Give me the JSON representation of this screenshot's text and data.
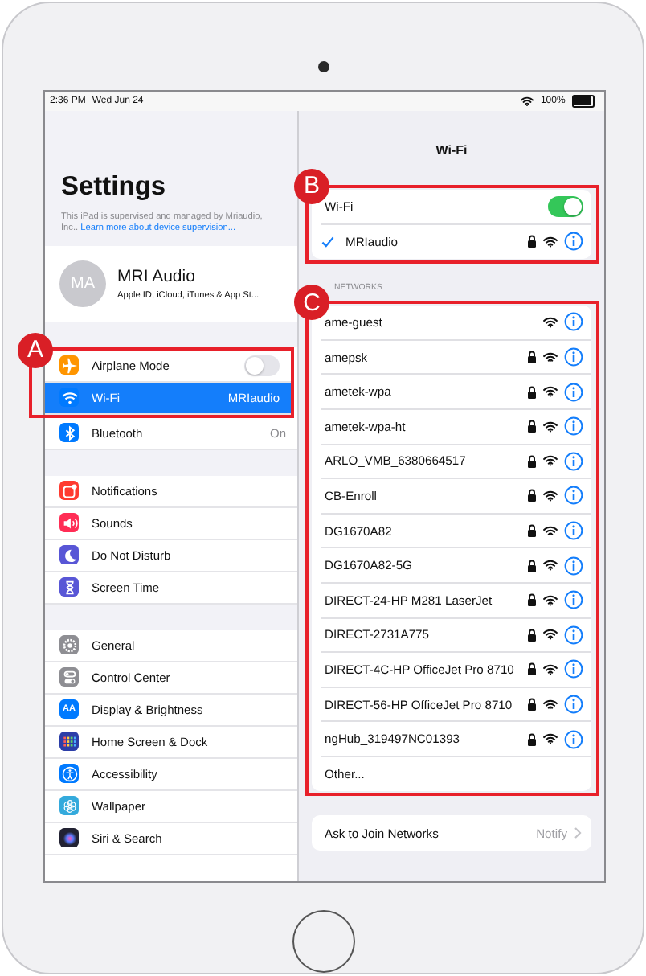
{
  "status_bar": {
    "time": "2:36 PM",
    "date": "Wed Jun 24",
    "battery": "100%"
  },
  "sidebar": {
    "title": "Settings",
    "notice": "This iPad is supervised and managed by Mriaudio, Inc.. ",
    "notice_link": "Learn more about device supervision...",
    "profile": {
      "initials": "MA",
      "name": "MRI Audio",
      "subtitle": "Apple ID, iCloud, iTunes & App St..."
    },
    "sections": [
      {
        "callout": "A",
        "items": [
          {
            "label": "Airplane Mode",
            "color": "#ff9500",
            "kind": "toggle",
            "on": false,
            "selected": false
          },
          {
            "label": "Wi-Fi",
            "color": "#007aff",
            "kind": "link",
            "value": "MRIaudio",
            "selected": true
          }
        ]
      },
      {
        "joined": true,
        "items": [
          {
            "label": "Bluetooth",
            "color": "#007aff",
            "kind": "link",
            "value": "On",
            "selected": false
          }
        ]
      },
      {
        "items": [
          {
            "label": "Notifications",
            "color": "#ff3b30",
            "kind": "link",
            "selected": false
          },
          {
            "label": "Sounds",
            "color": "#ff2d55",
            "kind": "link",
            "selected": false
          },
          {
            "label": "Do Not Disturb",
            "color": "#5856d6",
            "kind": "link",
            "selected": false
          },
          {
            "label": "Screen Time",
            "color": "#5856d6",
            "kind": "link",
            "selected": false
          }
        ]
      },
      {
        "items": [
          {
            "label": "General",
            "color": "#8e8e93",
            "kind": "link",
            "selected": false
          },
          {
            "label": "Control Center",
            "color": "#8e8e93",
            "kind": "link",
            "selected": false
          },
          {
            "label": "Display & Brightness",
            "glyph": "AA",
            "color": "#007aff",
            "kind": "link",
            "selected": false
          },
          {
            "label": "Home Screen & Dock",
            "color": "#2c3ea8",
            "kind": "link",
            "selected": false
          },
          {
            "label": "Accessibility",
            "color": "#007aff",
            "kind": "link",
            "selected": false
          },
          {
            "label": "Wallpaper",
            "color": "#34aadc",
            "kind": "link",
            "selected": false
          },
          {
            "label": "Siri & Search",
            "color": "#222233",
            "kind": "link",
            "selected": false
          }
        ]
      }
    ]
  },
  "wifi": {
    "title": "Wi-Fi",
    "callout": "B",
    "toggle": {
      "label": "Wi-Fi",
      "on": true
    },
    "current": {
      "name": "MRIaudio",
      "locked": true,
      "connected": true
    },
    "networks_header": "NETWORKS",
    "networks_callout": "C",
    "networks": [
      {
        "name": "ame-guest",
        "locked": false
      },
      {
        "name": "amepsk",
        "locked": true
      },
      {
        "name": "ametek-wpa",
        "locked": true
      },
      {
        "name": "ametek-wpa-ht",
        "locked": true
      },
      {
        "name": "ARLO_VMB_6380664517",
        "locked": true
      },
      {
        "name": "CB-Enroll",
        "locked": true
      },
      {
        "name": "DG1670A82",
        "locked": true
      },
      {
        "name": "DG1670A82-5G",
        "locked": true
      },
      {
        "name": "DIRECT-24-HP M281 LaserJet",
        "locked": true
      },
      {
        "name": "DIRECT-2731A775",
        "locked": true
      },
      {
        "name": "DIRECT-4C-HP OfficeJet Pro 8710",
        "locked": true
      },
      {
        "name": "DIRECT-56-HP OfficeJet Pro 8710",
        "locked": true
      },
      {
        "name": "ngHub_319497NC01393",
        "locked": true
      }
    ],
    "other": "Other...",
    "ask": {
      "label": "Ask to Join Networks",
      "value": "Notify"
    }
  }
}
